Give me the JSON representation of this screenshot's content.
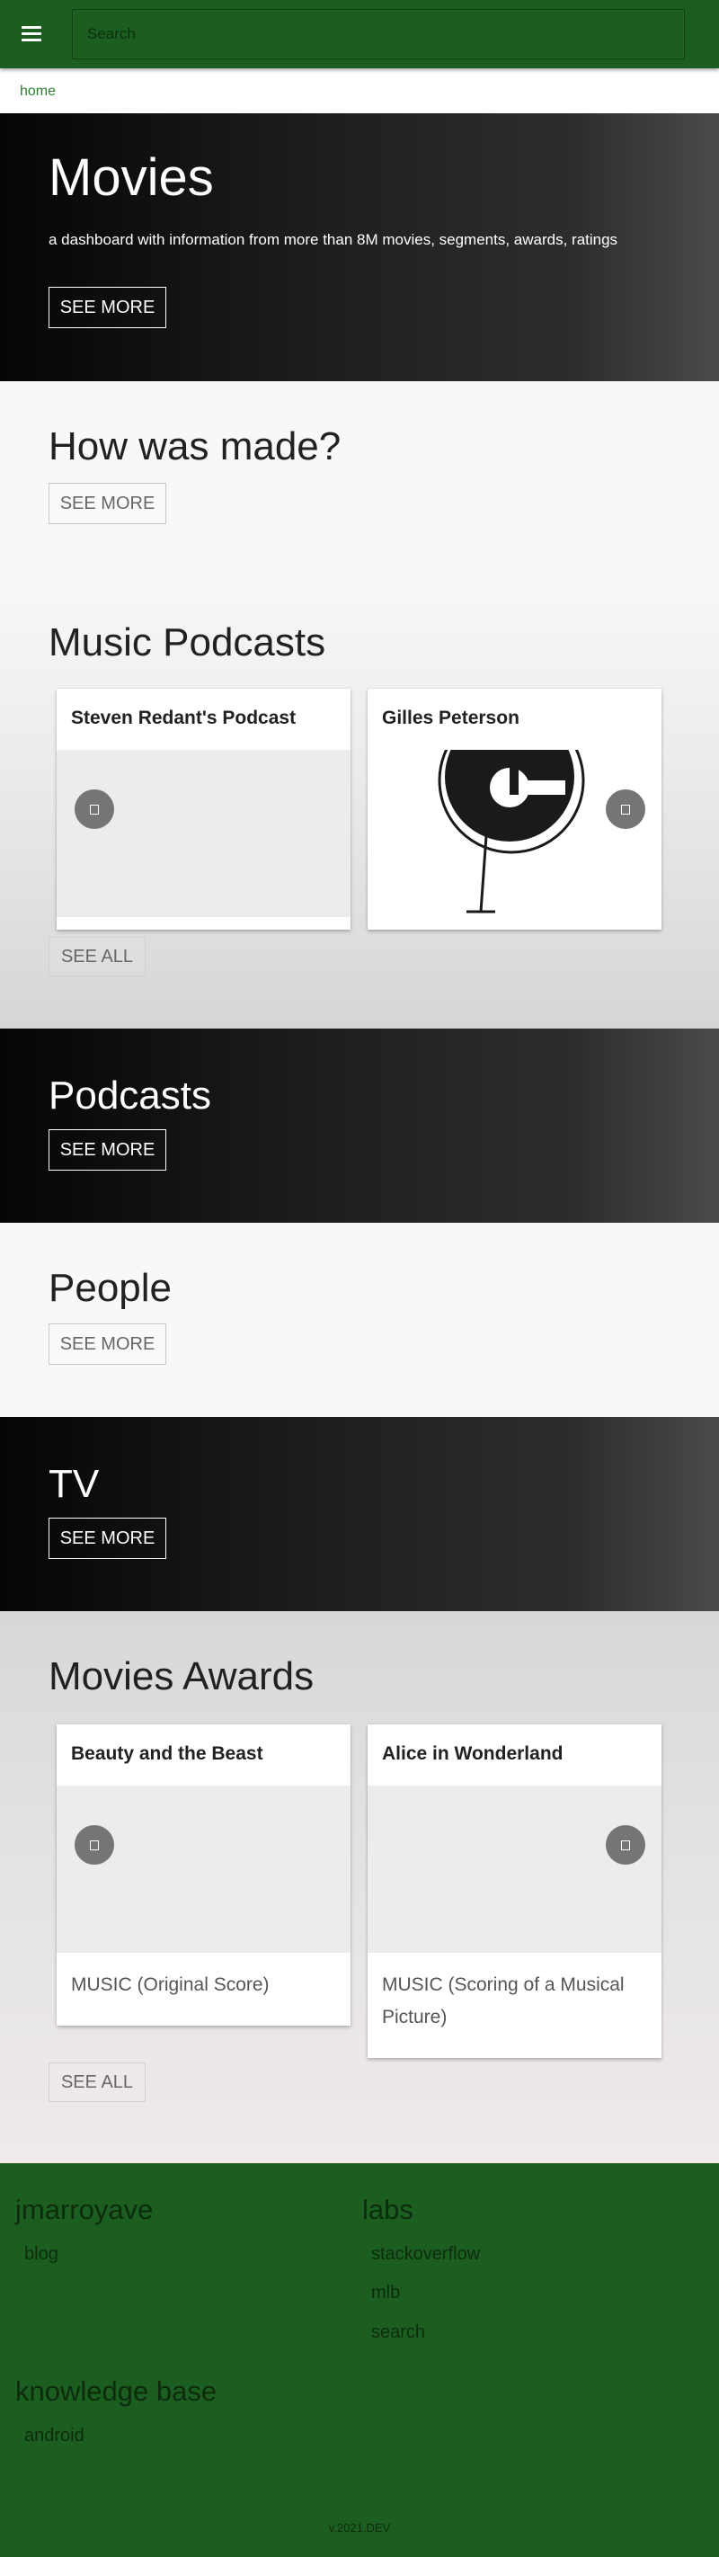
{
  "search": {
    "placeholder": "Search"
  },
  "breadcrumb": {
    "home": "home"
  },
  "movies_hero": {
    "title": "Movies",
    "subtitle": "a dashboard with information from more than 8M movies, segments, awards, ratings",
    "button": "SEE MORE"
  },
  "how_made": {
    "title": "How was made?",
    "button": "SEE MORE"
  },
  "music_podcasts": {
    "title": "Music Podcasts",
    "cards": [
      {
        "title": "Steven Redant's Podcast"
      },
      {
        "title": "Gilles Peterson"
      }
    ],
    "see_all": "SEE ALL"
  },
  "podcasts": {
    "title": "Podcasts",
    "button": "SEE MORE"
  },
  "people": {
    "title": "People",
    "button": "SEE MORE"
  },
  "tv": {
    "title": "TV",
    "button": "SEE MORE"
  },
  "movies_awards": {
    "title": "Movies Awards",
    "cards": [
      {
        "title": "Beauty and the Beast",
        "award": "MUSIC (Original Score)"
      },
      {
        "title": "Alice in Wonderland",
        "award": "MUSIC (Scoring of a Musical Picture)"
      }
    ],
    "see_all": "SEE ALL"
  },
  "footer": {
    "col1": {
      "heading": "jmarroyave",
      "links": [
        "blog"
      ]
    },
    "col2": {
      "heading": "labs",
      "links": [
        "stackoverflow",
        "mlb",
        "search"
      ]
    },
    "col3": {
      "heading": "knowledge base",
      "links": [
        "android"
      ]
    },
    "version": "v.2021.DEV"
  },
  "colors": {
    "primary": "#1b5e20",
    "link": "#2e7d32",
    "dark_section": "#1e1e1e",
    "play_button": "#757575"
  },
  "icons": {
    "menu": "hamburger-menu-icon",
    "play": "play-icon",
    "podcast_logo": "gilles-peterson-logo"
  }
}
